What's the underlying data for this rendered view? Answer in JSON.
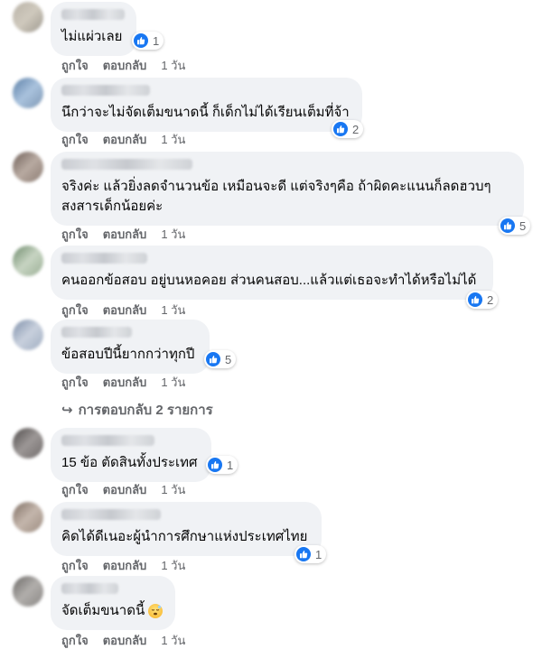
{
  "actions": {
    "like": "ถูกใจ",
    "reply": "ตอบกลับ"
  },
  "colors": {
    "bubble": "#f0f2f5",
    "like_blue": "#1877f2",
    "meta_gray": "#65676b"
  },
  "comments": [
    {
      "lines": [
        "ไม่แผ่วเลย"
      ],
      "reaction_icon": "like-icon",
      "reaction_count": "1",
      "time": "1 วัน"
    },
    {
      "lines": [
        "นึกว่าจะไม่จัดเต็มขนาดนี้ ก็เด็กไม่ได้เรียนเต็มที่จ้า"
      ],
      "reaction_icon": "like-icon",
      "reaction_count": "2",
      "time": "1 วัน"
    },
    {
      "lines": [
        "จริงค่ะ แล้วยิ่งลดจำนวนข้อ เหมือนจะดี แต่จริงๆคือ ถ้าผิดคะแนนก็ลดฮวบๆ",
        "สงสารเด็กน้อยค่ะ"
      ],
      "reaction_icon": "like-icon",
      "reaction_count": "5",
      "time": "1 วัน"
    },
    {
      "lines": [
        "คนออกข้อสอบ อยู่บนหอคอย ส่วนคนสอบ...แล้วแต่เธอจะทำได้หรือไม่ได้"
      ],
      "reaction_icon": "like-icon",
      "reaction_count": "2",
      "time": "1 วัน"
    },
    {
      "lines": [
        "ข้อสอบปีนี้ยากกว่าทุกปี"
      ],
      "reaction_icon": "like-icon",
      "reaction_count": "5",
      "time": "1 วัน",
      "replies_label": "การตอบกลับ 2 รายการ"
    },
    {
      "lines": [
        "15 ข้อ ตัดสินทั้งประเทศ"
      ],
      "reaction_icon": "like-icon",
      "reaction_count": "1",
      "time": "1 วัน"
    },
    {
      "lines": [
        "คิดได้ดีเนอะผู้นำการศึกษาแห่งประเทศไทย"
      ],
      "reaction_icon": "like-icon",
      "reaction_count": "1",
      "time": "1 วัน"
    },
    {
      "lines": [
        "จัดเต็มขนาดนี้"
      ],
      "emoji_icon": "sleepy-face-icon",
      "time": "1 วัน"
    }
  ]
}
